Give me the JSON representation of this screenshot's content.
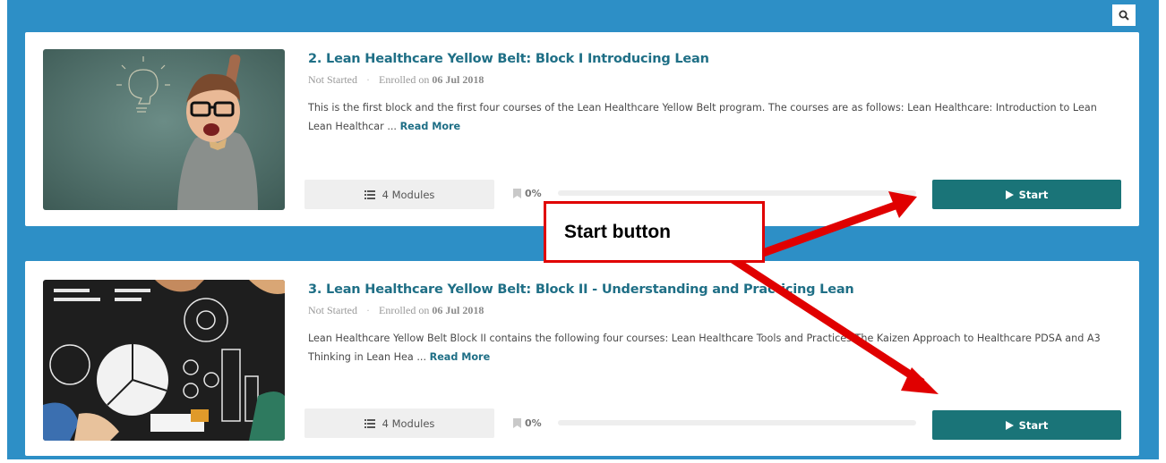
{
  "courses": [
    {
      "title": "2. Lean Healthcare Yellow Belt: Block I Introducing Lean",
      "status": "Not Started",
      "separator": "·",
      "enrolled_prefix": "Enrolled on",
      "enrolled_date": "06 Jul 2018",
      "description": "This is the first block and the first four courses of the Lean Healthcare Yellow Belt program. The courses are as follows: Lean Healthcare: Introduction to Lean Lean Healthcar ...",
      "read_more_label": "Read More",
      "modules_label": "4 Modules",
      "progress_label": "0%",
      "progress_value": 0,
      "start_label": "Start",
      "thumbnail_icon": "boy-with-lightbulb-image"
    },
    {
      "title": "3. Lean Healthcare Yellow Belt: Block II - Understanding and Practicing Lean",
      "status": "Not Started",
      "separator": "·",
      "enrolled_prefix": "Enrolled on",
      "enrolled_date": "06 Jul 2018",
      "description": "Lean Healthcare Yellow Belt Block II contains the following four courses: Lean Healthcare Tools and Practices The Kaizen Approach to Healthcare PDSA and A3 Thinking in Lean Hea ...",
      "read_more_label": "Read More",
      "modules_label": "4 Modules",
      "progress_label": "0%",
      "progress_value": 0,
      "start_label": "Start",
      "thumbnail_icon": "team-charts-chalkboard-image"
    }
  ],
  "annotation": {
    "callout_text": "Start button",
    "arrow_color": "#e00000"
  },
  "colors": {
    "page_blue": "#2d8fc6",
    "accent_teal": "#1a7478",
    "title_teal": "#1f6f86"
  }
}
